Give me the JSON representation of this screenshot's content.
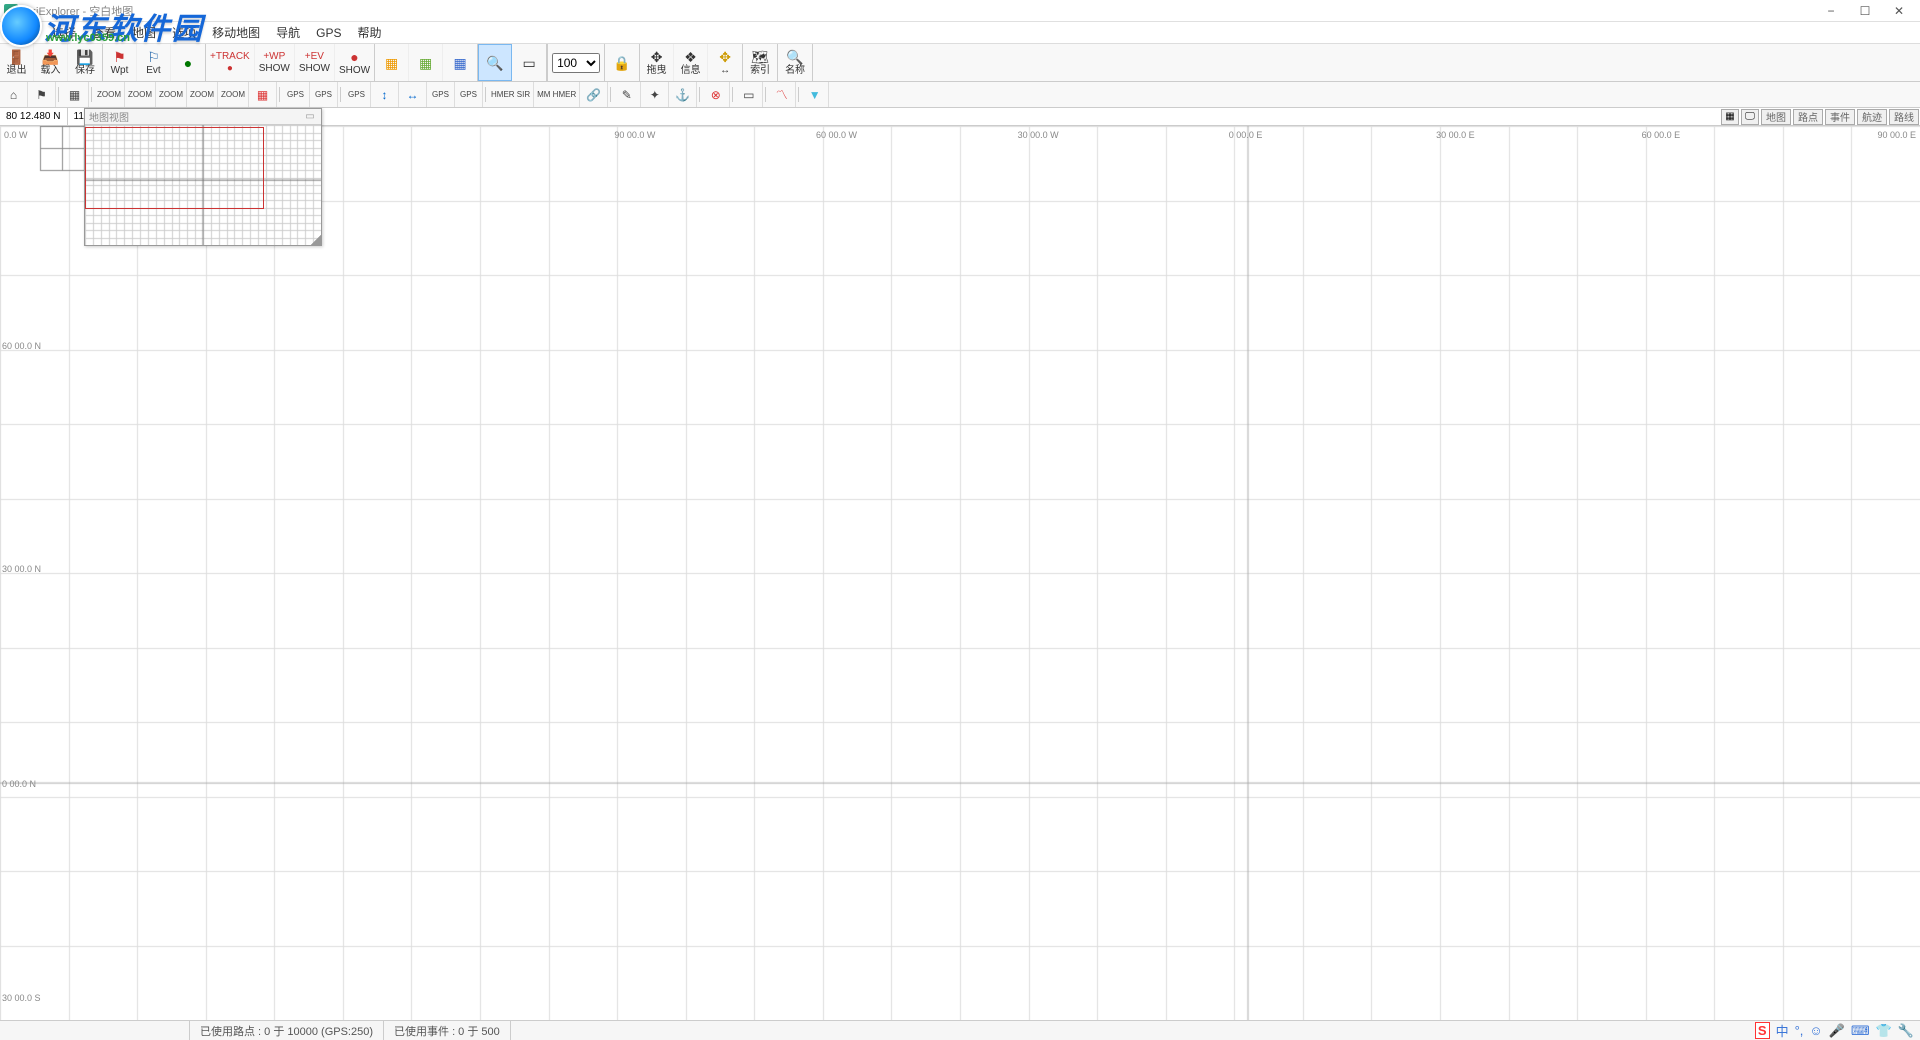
{
  "window": {
    "title": "OziExplorer - 空白地图"
  },
  "menus": [
    "文件",
    "选择",
    "查看",
    "地图",
    "选项",
    "移动地图",
    "导航",
    "GPS",
    "帮助"
  ],
  "watermark": {
    "text": "河东软件园",
    "url": "www.lyc0359.cn"
  },
  "toolbar": {
    "exit": "退出",
    "load": "载入",
    "save": "保存",
    "wpt": "Wpt",
    "evt": "Evt",
    "track_rec": "+TRACK",
    "wp_rec": "+WP",
    "ev_rec": "+EV",
    "show1": "SHOW",
    "show2": "SHOW",
    "show3": "SHOW",
    "drag": "拖曳",
    "info": "信息",
    "pan": "↔",
    "index": "索引",
    "name": "名称",
    "zoom_sel": "100"
  },
  "toolbar2": {
    "zoom": "ZOOM",
    "gps": "GPS",
    "hmer": "HMER\nSIR",
    "mm": "MM\nHMER"
  },
  "coords": {
    "lat": "80 12.480 N",
    "lon": "11"
  },
  "right_tabs": [
    "地图",
    "路点",
    "事件",
    "航迹",
    "路线"
  ],
  "overview": {
    "title": "地图视图"
  },
  "map_labels_lon": [
    "0.0 W",
    "90 00.0 W",
    "60 00.0 W",
    "30 00.0 W",
    "0 00.0 E",
    "30 00.0 E",
    "60 00.0 E",
    "90 00.0 E"
  ],
  "map_labels_lat": [
    "60 00.0 N",
    "30 00.0 N",
    "0 00.0 N",
    "30 00.0 S"
  ],
  "status": {
    "waypoints": "已使用路点 : 0 于 10000  (GPS:250)",
    "events": "已使用事件 : 0 于 500"
  },
  "tray": {
    "ime": "中"
  }
}
